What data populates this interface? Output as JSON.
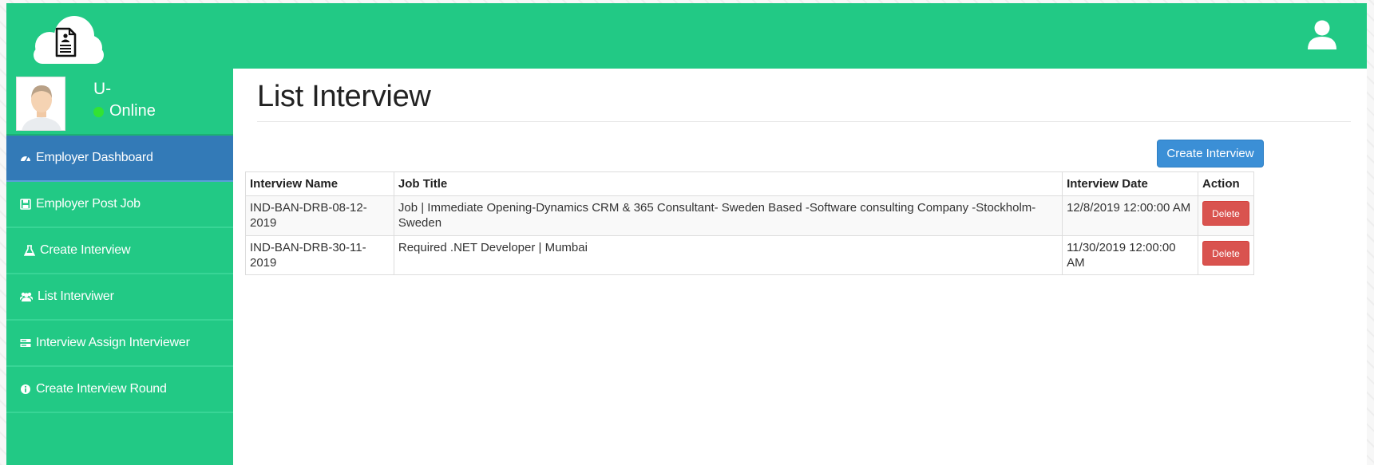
{
  "header": {
    "logo_icon": "cloud-document-icon",
    "user_icon": "user-icon",
    "brand_color": "#22c985"
  },
  "sidebar": {
    "profile": {
      "name": "U-",
      "status": "Online",
      "status_color": "#33e233"
    },
    "items": [
      {
        "label": "Employer Dashboard",
        "icon": "dashboard-icon",
        "active": true
      },
      {
        "label": "Employer Post Job",
        "icon": "save-icon",
        "active": false
      },
      {
        "label": "Create Interview",
        "icon": "flask-icon",
        "active": false
      },
      {
        "label": "List Interviwer",
        "icon": "users-icon",
        "active": false
      },
      {
        "label": "Interview Assign Interviewer",
        "icon": "hdd-icon",
        "active": false
      },
      {
        "label": "Create Interview Round",
        "icon": "info-circle-icon",
        "active": false
      }
    ]
  },
  "main": {
    "title": "List Interview",
    "create_button": "Create Interview",
    "table": {
      "headers": [
        "Interview Name",
        "Job Title",
        "Interview Date",
        "Action"
      ],
      "rows": [
        {
          "interview_name": "IND-BAN-DRB-08-12-2019",
          "job_title": "Job | Immediate Opening-Dynamics CRM & 365 Consultant- Sweden Based -Software consulting Company -Stockholm-Sweden",
          "interview_date": "12/8/2019 12:00:00 AM",
          "action": "Delete"
        },
        {
          "interview_name": "IND-BAN-DRB-30-11-2019",
          "job_title": "Required .NET Developer | Mumbai",
          "interview_date": "11/30/2019 12:00:00 AM",
          "action": "Delete"
        }
      ]
    }
  },
  "colors": {
    "primary": "#337ab7",
    "danger": "#d9534f",
    "button_blue": "#3b8fd6"
  }
}
